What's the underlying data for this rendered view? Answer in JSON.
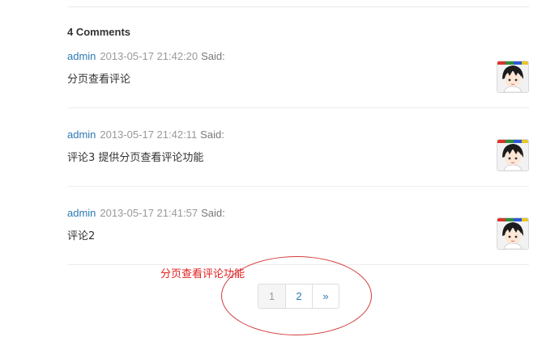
{
  "comments_heading": "4 Comments",
  "comments": [
    {
      "author": "admin",
      "date": "2013-05-17 21:42:20",
      "said": "Said:",
      "text": "分页查看评论"
    },
    {
      "author": "admin",
      "date": "2013-05-17 21:42:11",
      "said": "Said:",
      "text": "评论3 提供分页查看评论功能"
    },
    {
      "author": "admin",
      "date": "2013-05-17 21:41:57",
      "said": "Said:",
      "text": "评论2"
    }
  ],
  "annotation": "分页查看评论功能",
  "pagination": {
    "current": "1",
    "page2": "2",
    "next": "»"
  },
  "colors": {
    "link": "#2a7ab5",
    "annotation": "#e02020",
    "date": "#999999"
  }
}
